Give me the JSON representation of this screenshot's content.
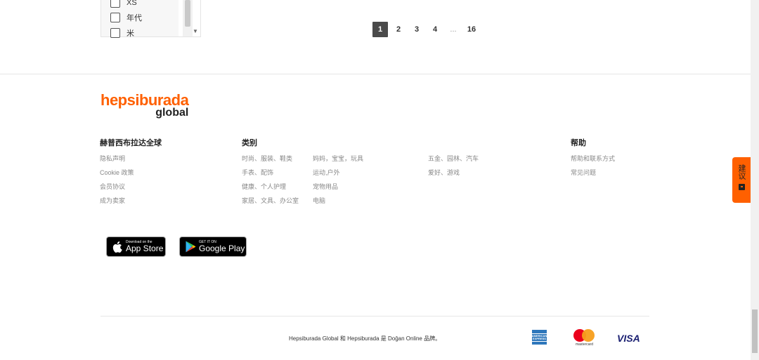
{
  "filter": {
    "options": [
      {
        "label": "XS",
        "checked": false
      },
      {
        "label": "年代",
        "checked": false
      },
      {
        "label": "米",
        "checked": false
      }
    ]
  },
  "pagination": {
    "pages": [
      "1",
      "2",
      "3",
      "4",
      "...",
      "16"
    ],
    "current": "1"
  },
  "logo": {
    "top": "hepsiburada",
    "bottom": "global"
  },
  "columns": {
    "global": {
      "title": "赫普西布拉达全球",
      "links": [
        "隐私声明",
        "Cookie 政策",
        "会员协议",
        "成为卖家"
      ]
    },
    "categories": {
      "title": "类别",
      "col1": [
        "时尚、服装、鞋类",
        "手表、配饰",
        "健康、个人护理",
        "家居、文具、办公室"
      ],
      "col2": [
        "妈妈，宝宝，玩具",
        "运动,户外",
        "宠物用品",
        "电脑"
      ],
      "col3": [
        "五金、园林、汽车",
        "爱好、游戏"
      ]
    },
    "help": {
      "title": "帮助",
      "links": [
        "帮助和联系方式",
        "常见问题"
      ]
    }
  },
  "stores": {
    "apple": {
      "small": "Download on the",
      "big": "App Store"
    },
    "google": {
      "small": "GET IT ON",
      "big": "Google Play"
    }
  },
  "footer": {
    "note": "Hepsiburada Global 和 Hepsiburada 是 Doğan Online 品牌。",
    "amex": "AMERICAN EXPRESS",
    "mastercard": "mastercard",
    "visa": "VISA"
  },
  "feedback": {
    "label": "建议"
  },
  "colors": {
    "brand": "#ff6000",
    "active_page": "#4a4a4a"
  }
}
